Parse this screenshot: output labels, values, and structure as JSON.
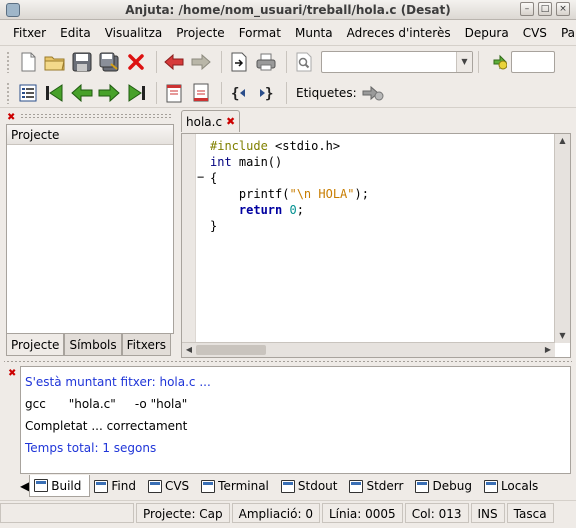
{
  "window": {
    "title": "Anjuta: /home/nom_usuari/treball/hola.c (Desat)",
    "buttons": {
      "minimize": "–",
      "maximize": "□",
      "close": "×"
    }
  },
  "menubar": [
    "Fitxer",
    "Edita",
    "Visualitza",
    "Projecte",
    "Format",
    "Munta",
    "Adreces d'interès",
    "Depura",
    "CVS",
    "Parà"
  ],
  "toolbar": {
    "search_value": "",
    "goto_value": "",
    "bookmarks_label": "Etiquetes:"
  },
  "left_panel": {
    "header": "Projecte",
    "tabs": [
      "Projecte",
      "Símbols",
      "Fitxers"
    ],
    "active_tab": "Projecte"
  },
  "editor": {
    "tab_label": "hola.c",
    "fold_marker": "−",
    "code_tokens": {
      "l1_include": "#include",
      "l1_header": " <stdio.h>",
      "l2_type": "int",
      "l2_rest": " main()",
      "l3": "{",
      "l4_indent": "    ",
      "l4_call": "printf(",
      "l4_string": "\"\\n HOLA\"",
      "l4_end": ");",
      "l5_indent": "    ",
      "l5_kw": "return",
      "l5_sp": " ",
      "l5_num": "0",
      "l5_end": ";",
      "l6": "}"
    }
  },
  "messages": {
    "lines": [
      {
        "text": "S'està muntant fitxer: hola.c ...",
        "color": "#1f35d8"
      },
      {
        "text": "gcc      \"hola.c\"     -o \"hola\"",
        "color": "#000000"
      },
      {
        "text": "Completat ... correctament",
        "color": "#000000"
      },
      {
        "text": "Temps total: 1 segons",
        "color": "#1f35d8"
      }
    ],
    "tabs": [
      "Build",
      "Find",
      "CVS",
      "Terminal",
      "Stdout",
      "Stderr",
      "Debug",
      "Locals"
    ],
    "active_tab": "Build"
  },
  "statusbar": {
    "project": "Projecte: Cap",
    "zoom": "Ampliació: 0",
    "line": "Línia: 0005",
    "col": "Col: 013",
    "mode": "INS",
    "tasca": "Tasca"
  }
}
